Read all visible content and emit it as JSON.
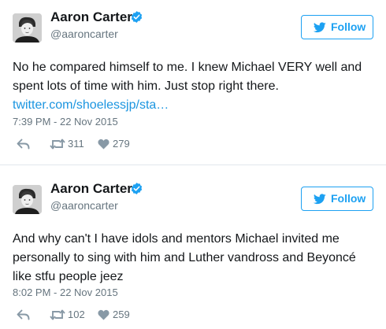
{
  "tweets": [
    {
      "name": "Aaron Carter",
      "handle": "@aaroncarter",
      "follow_label": "Follow",
      "text_lines": [
        "No he compared himself to me. I knew Michael VERY well and",
        "spent lots of time with him. Just stop right there."
      ],
      "link_text": "twitter.com/shoelessjp/sta…",
      "timestamp": "7:39 PM - 22 Nov 2015",
      "retweets": "311",
      "likes": "279"
    },
    {
      "name": "Aaron Carter",
      "handle": "@aaroncarter",
      "follow_label": "Follow",
      "text_lines": [
        "And why can't I have idols and mentors Michael invited me",
        "personally to sing with him and Luther vandross and Beyoncé",
        "like stfu people jeez"
      ],
      "timestamp": "8:02 PM - 22 Nov 2015",
      "retweets": "102",
      "likes": "259"
    }
  ],
  "icons": {
    "verified": "verified-badge-icon",
    "bird": "twitter-bird-icon",
    "reply": "reply-icon",
    "retweet": "retweet-icon",
    "like": "heart-icon"
  },
  "colors": {
    "accent": "#1da1f2",
    "link": "#1b95e0",
    "muted": "#66757f",
    "text": "#14171a",
    "divider": "#e1e8ed"
  }
}
